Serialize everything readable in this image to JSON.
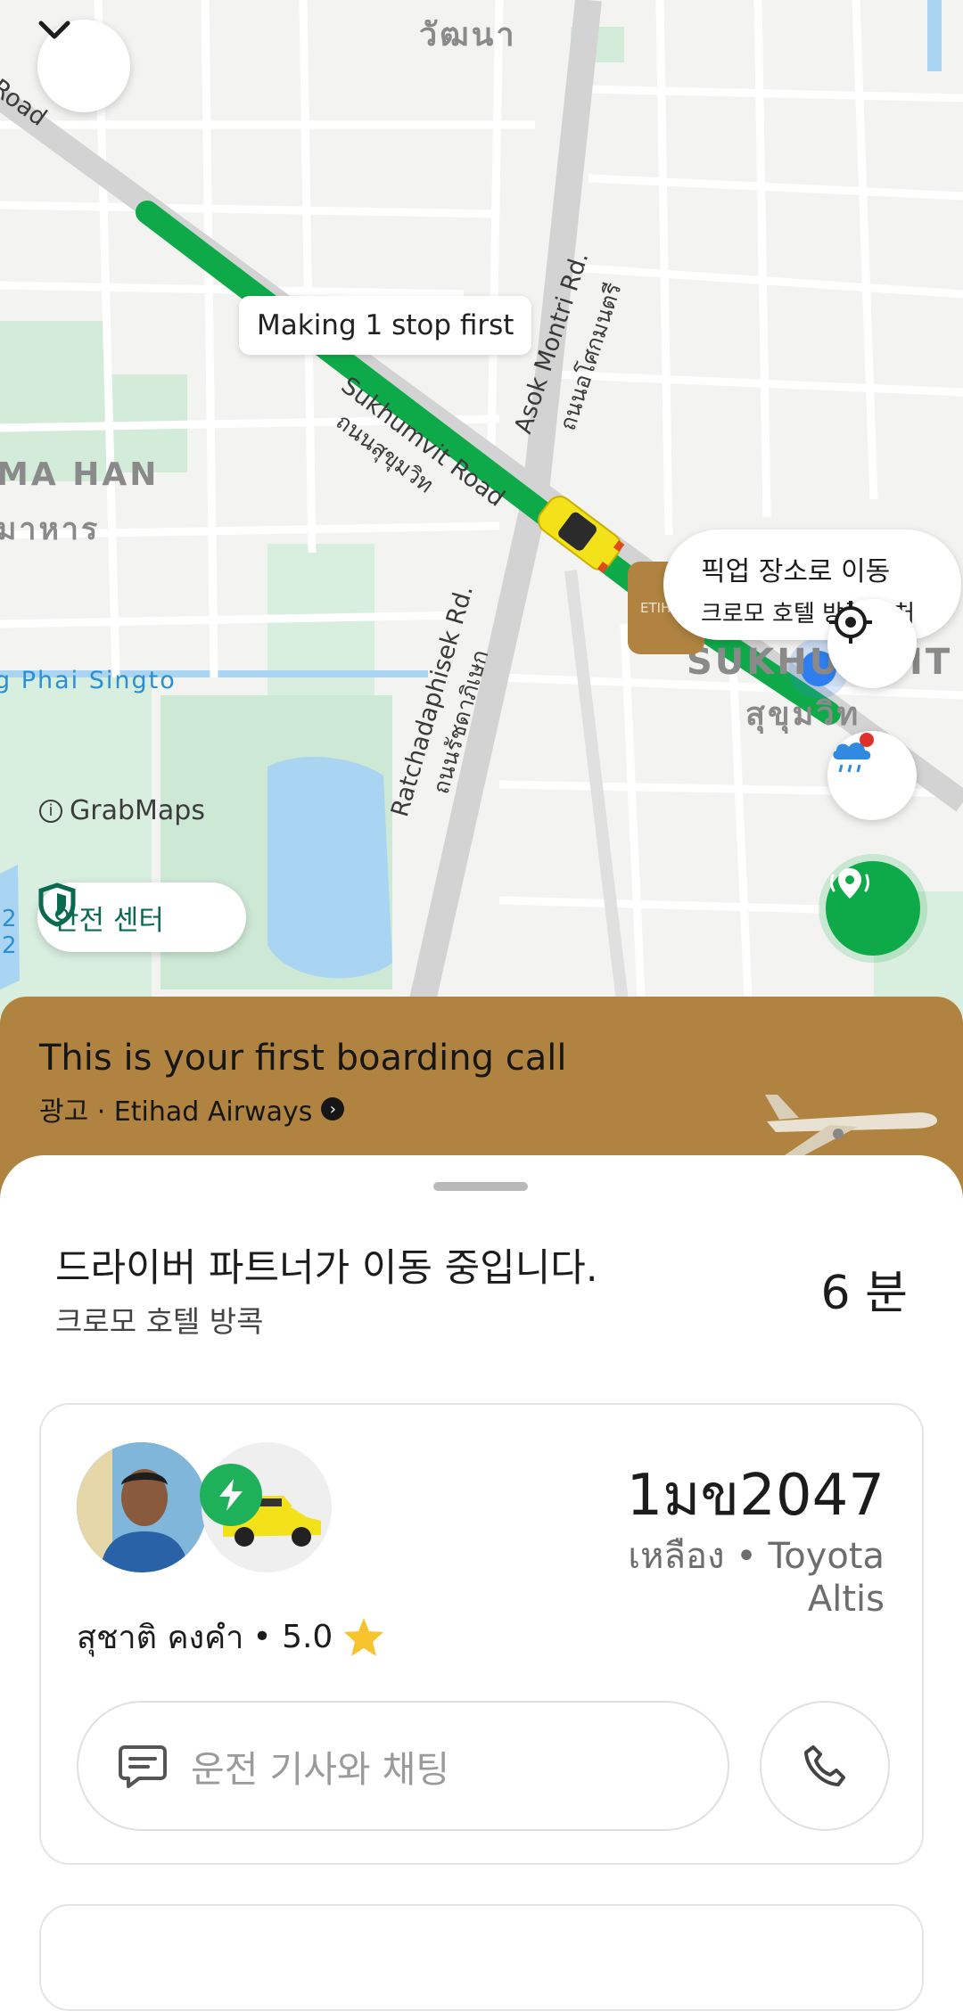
{
  "map": {
    "labels": {
      "top_thai": "วัฒนา",
      "road_top_left": "Road",
      "ma_han": "MA HAN",
      "ma_han_thai": "มาหาร",
      "phai_singto": "g Phai Singto",
      "sukhumvit_road": "Sukhumvit Road",
      "sukhumvit_road_thai": "ถนนสุขุมวิท",
      "asok_montri": "Asok Montri Rd.",
      "asok_montri_thai": "ถนนอโศกมนตรี",
      "ratchadaphisek": "Ratchadaphisek Rd.",
      "ratchadaphisek_thai": "ถนนรัชดาภิเษก",
      "sukhumvit_area": "SUKHUMVIT",
      "sukhumvit_area_thai": "สุขุมวิท",
      "left_edge_num_1": "2",
      "left_edge_num_2": "2"
    },
    "stop_tooltip": "Making 1 stop first",
    "pickup_bubble": {
      "line1": "픽업 장소로 이동",
      "line2": "크로모 호텔 방콕 근처"
    },
    "etihad_pin_text": "ETIHAD",
    "attribution": "GrabMaps",
    "safety_center": "안전 센터",
    "colors": {
      "route": "#0eaa4a",
      "water": "#a9d5f2",
      "park": "#c9e7d2",
      "road_major": "#cfcfcf"
    },
    "icons": [
      "chevron-down-icon",
      "locate-icon",
      "weather-rain-icon",
      "shield-icon",
      "live-location-icon"
    ]
  },
  "ad": {
    "title": "This is your first boarding call",
    "label": "광고 · Etihad Airways",
    "color": "#b08440"
  },
  "trip": {
    "status": "드라이버 파트너가 이동 중입니다.",
    "destination": "크로모 호텔 방콕",
    "eta": "6 분"
  },
  "driver": {
    "plate": "1มข2047",
    "car": "เหลือง • Toyota Altis",
    "name": "สุชาติ คงคำ",
    "rating_text": "• 5.0",
    "rating": 5.0,
    "chat_placeholder": "운전 기사와 채팅"
  }
}
